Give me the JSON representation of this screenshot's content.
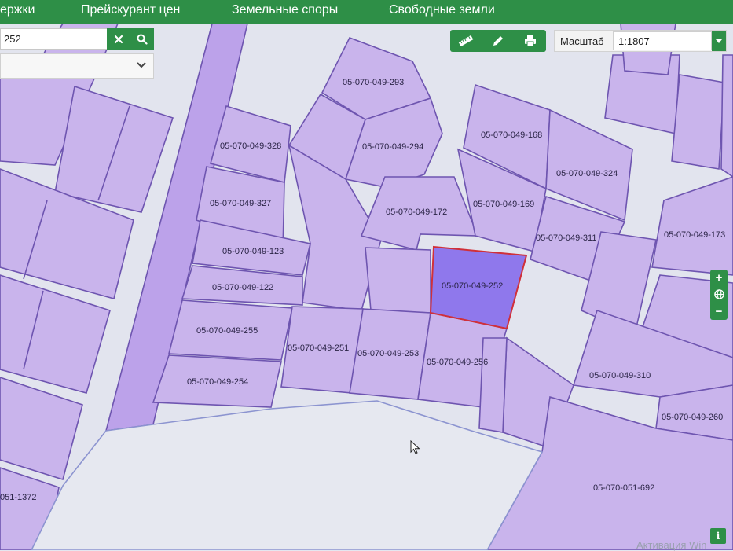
{
  "nav": {
    "items": [
      "ержки",
      "Прейскурант цен",
      "Земельные споры",
      "Свободные земли"
    ]
  },
  "search": {
    "value": "252",
    "clear_icon": "close-icon",
    "search_icon": "search-icon"
  },
  "dropdown": {
    "value": "",
    "icon": "chevron-down-icon"
  },
  "toolbar": {
    "icons": [
      "ruler-icon",
      "pencil-icon",
      "printer-icon"
    ]
  },
  "scale": {
    "label": "Масштаб",
    "value": "1:1807"
  },
  "zoom": {
    "plus": "+",
    "minus": "−",
    "globe_icon": "globe-icon"
  },
  "info_label": "i",
  "watermark": "Активация Win",
  "parcels": {
    "p293": "05-070-049-293",
    "p328": "05-070-049-328",
    "p294": "05-070-049-294",
    "p168": "05-070-049-168",
    "p324": "05-070-049-324",
    "p327": "05-070-049-327",
    "p172": "05-070-049-172",
    "p169": "05-070-049-169",
    "p173": "05-070-049-173",
    "p311": "05-070-049-311",
    "p123": "05-070-049-123",
    "p252": "05-070-049-252",
    "p122": "05-070-049-122",
    "p255": "05-070-049-255",
    "p251": "05-070-049-251",
    "p253": "05-070-049-253",
    "p256": "05-070-049-256",
    "p310": "05-070-049-310",
    "p254": "05-070-049-254",
    "p260": "05-070-049-260",
    "p692": "05-070-051-692",
    "p1372": "051-1372"
  },
  "colors": {
    "accent": "#2e8f47",
    "parcel_fill": "#c9b4ec",
    "parcel_border": "#6e55b0",
    "selected_fill": "#8f78ec",
    "selected_border": "#d0303a"
  }
}
